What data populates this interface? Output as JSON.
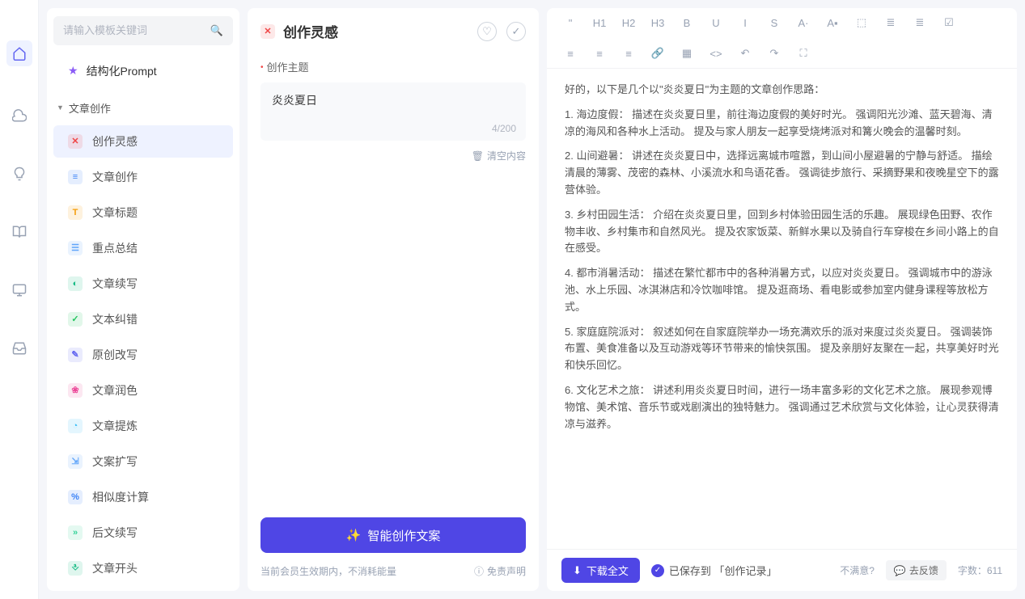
{
  "rail": {
    "icons": [
      "home",
      "cloud",
      "bulb",
      "book",
      "monitor",
      "inbox"
    ]
  },
  "sidebar": {
    "search_placeholder": "请输入模板关键词",
    "pinned": {
      "label": "结构化Prompt"
    },
    "category": "文章创作",
    "items": [
      {
        "label": "创作灵感",
        "color": "#ef4444",
        "active": true,
        "glyph": "✕"
      },
      {
        "label": "文章创作",
        "color": "#3b82f6",
        "glyph": "≡"
      },
      {
        "label": "文章标题",
        "color": "#f59e0b",
        "glyph": "T"
      },
      {
        "label": "重点总结",
        "color": "#60a5fa",
        "glyph": "☰"
      },
      {
        "label": "文章续写",
        "color": "#10b981",
        "glyph": "◐"
      },
      {
        "label": "文本纠错",
        "color": "#22c55e",
        "glyph": "✓"
      },
      {
        "label": "原创改写",
        "color": "#6366f1",
        "glyph": "✎"
      },
      {
        "label": "文章润色",
        "color": "#ec4899",
        "glyph": "❀"
      },
      {
        "label": "文章提炼",
        "color": "#38bdf8",
        "glyph": "◔"
      },
      {
        "label": "文案扩写",
        "color": "#60a5fa",
        "glyph": "⇲"
      },
      {
        "label": "相似度计算",
        "color": "#3b82f6",
        "glyph": "%"
      },
      {
        "label": "后文续写",
        "color": "#34d399",
        "glyph": "»"
      },
      {
        "label": "文章开头",
        "color": "#10b981",
        "glyph": "⎀"
      }
    ]
  },
  "mid": {
    "title": "创作灵感",
    "title_icon_color": "#ef4444",
    "field_label": "创作主题",
    "field_value": "炎炎夏日",
    "char_count": "4/200",
    "clear_label": "清空内容",
    "generate_label": "智能创作文案",
    "footer_left": "当前会员生效期内，不消耗能量",
    "footer_right": "免责声明"
  },
  "editor": {
    "toolbar_row1": [
      "\"",
      "H1",
      "H2",
      "H3",
      "B",
      "U",
      "I",
      "S",
      "A·",
      "A▪",
      "⬚",
      "≣",
      "≣",
      "☑"
    ],
    "toolbar_row2": [
      "≡",
      "≡",
      "≡",
      "🔗",
      "▦",
      "<>",
      "↶",
      "↷",
      "⛶"
    ],
    "paragraphs": [
      "好的，以下是几个以\"炎炎夏日\"为主题的文章创作思路：",
      "1. 海边度假： 描述在炎炎夏日里，前往海边度假的美好时光。 强调阳光沙滩、蓝天碧海、清凉的海风和各种水上活动。 提及与家人朋友一起享受烧烤派对和篝火晚会的温馨时刻。",
      "2. 山间避暑： 讲述在炎炎夏日中，选择远离城市喧嚣，到山间小屋避暑的宁静与舒适。 描绘清晨的薄雾、茂密的森林、小溪流水和鸟语花香。 强调徒步旅行、采摘野果和夜晚星空下的露营体验。",
      "3. 乡村田园生活： 介绍在炎炎夏日里，回到乡村体验田园生活的乐趣。 展现绿色田野、农作物丰收、乡村集市和自然风光。 提及农家饭菜、新鲜水果以及骑自行车穿梭在乡间小路上的自在感受。",
      "4. 都市消暑活动： 描述在繁忙都市中的各种消暑方式，以应对炎炎夏日。 强调城市中的游泳池、水上乐园、冰淇淋店和冷饮咖啡馆。 提及逛商场、看电影或参加室内健身课程等放松方式。",
      "5. 家庭庭院派对： 叙述如何在自家庭院举办一场充满欢乐的派对来度过炎炎夏日。 强调装饰布置、美食准备以及互动游戏等环节带来的愉快氛围。 提及亲朋好友聚在一起，共享美好时光和快乐回忆。",
      "6. 文化艺术之旅： 讲述利用炎炎夏日时间，进行一场丰富多彩的文化艺术之旅。 展现参观博物馆、美术馆、音乐节或戏剧演出的独特魅力。 强调通过艺术欣赏与文化体验，让心灵获得清凉与滋养。"
    ],
    "download_label": "下载全文",
    "saved_label": "已保存到 「创作记录」",
    "unsat_label": "不满意?",
    "feedback_label": "去反馈",
    "wordcount_label": "字数：",
    "wordcount_value": "611"
  }
}
